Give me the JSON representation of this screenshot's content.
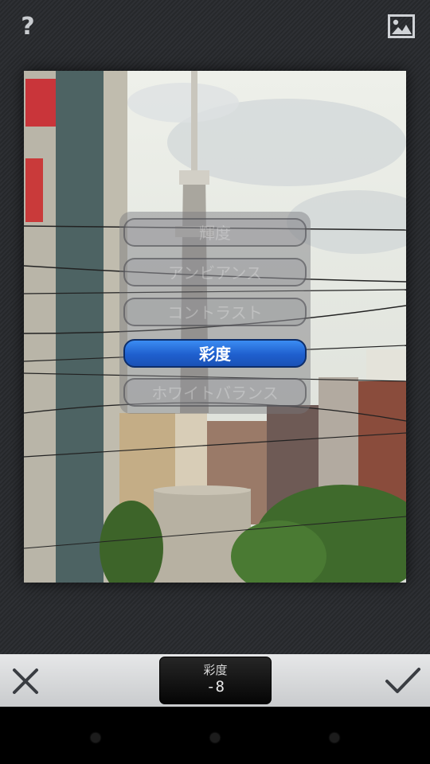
{
  "header": {
    "help_icon": "question-mark-icon",
    "help_glyph": "?",
    "gallery_icon": "image-icon"
  },
  "menu": {
    "items": [
      {
        "label": "輝度",
        "active": false
      },
      {
        "label": "アンビアンス",
        "active": false
      },
      {
        "label": "コントラスト",
        "active": false
      },
      {
        "label": "彩度",
        "active": true
      },
      {
        "label": "ホワイトバランス",
        "active": false
      }
    ]
  },
  "toolbar": {
    "cancel_icon": "close-icon",
    "confirm_icon": "checkmark-icon",
    "adjust_label": "彩度",
    "adjust_value": "-8"
  },
  "colors": {
    "active_item": "#2a73e0",
    "toolbar_bg": "#d6d8da"
  }
}
